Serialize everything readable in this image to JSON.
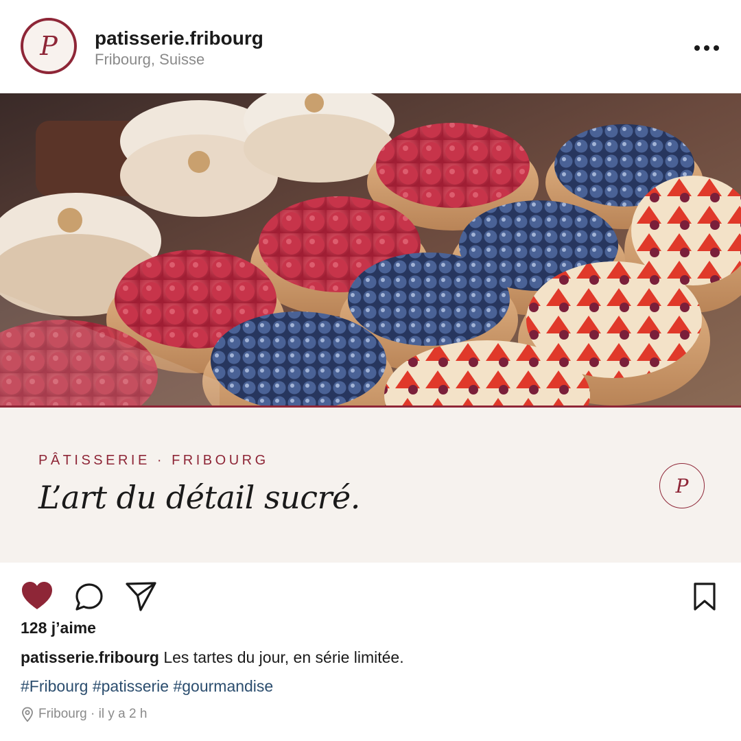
{
  "post": {
    "avatar_letter": "P",
    "username": "patisserie.fribourg",
    "location": "Fribourg, Suisse",
    "more_icon": "ellipsis-icon"
  },
  "photo": {
    "subject": "tarts-display"
  },
  "banner": {
    "kicker": "PÂTISSERIE · FRIBOURG",
    "tagline": "L’art du détail sucré.",
    "monogram": "P",
    "accent_color": "#8e2637",
    "background_color": "#f6f2ee"
  },
  "actions": {
    "like_icon": "heart-filled-icon",
    "comment_icon": "comment-icon",
    "share_icon": "send-icon",
    "save_icon": "bookmark-icon",
    "likes_text": "128 j’aime"
  },
  "caption": {
    "username": "patisserie.fribourg",
    "text": "Les tartes du jour, en série limitée."
  },
  "hashtags": [
    "#Fribourg",
    "#patisserie",
    "#gourmandise"
  ],
  "meta": {
    "pin_icon": "location-pin-icon",
    "text": "Fribourg · il y a 2 h"
  },
  "colors": {
    "like": "#8e2637",
    "hashtag": "#2b4d6e",
    "muted": "#8a8a8a"
  }
}
